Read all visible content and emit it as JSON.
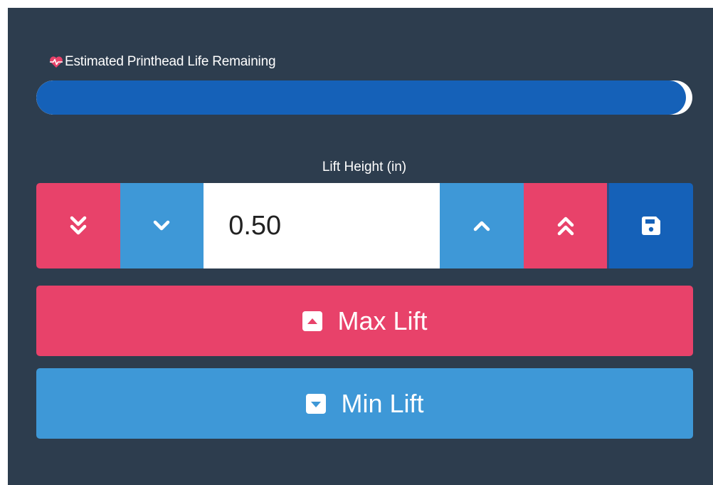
{
  "life": {
    "label": "Estimated Printhead Life Remaining",
    "icon": "heartbeat-icon",
    "fraction": 0.99
  },
  "lift": {
    "label": "Lift Height (in)",
    "value": "0.50",
    "buttons": {
      "big_down": "double-chevron-down-icon",
      "small_down": "chevron-down-icon",
      "small_up": "chevron-up-icon",
      "big_up": "double-chevron-up-icon",
      "save": "save-icon"
    }
  },
  "actions": {
    "max_lift": "Max Lift",
    "min_lift": "Min Lift"
  },
  "colors": {
    "panel": "#2d3d4e",
    "red": "#e8426a",
    "blue": "#3e98d7",
    "navy": "#1561b8"
  }
}
